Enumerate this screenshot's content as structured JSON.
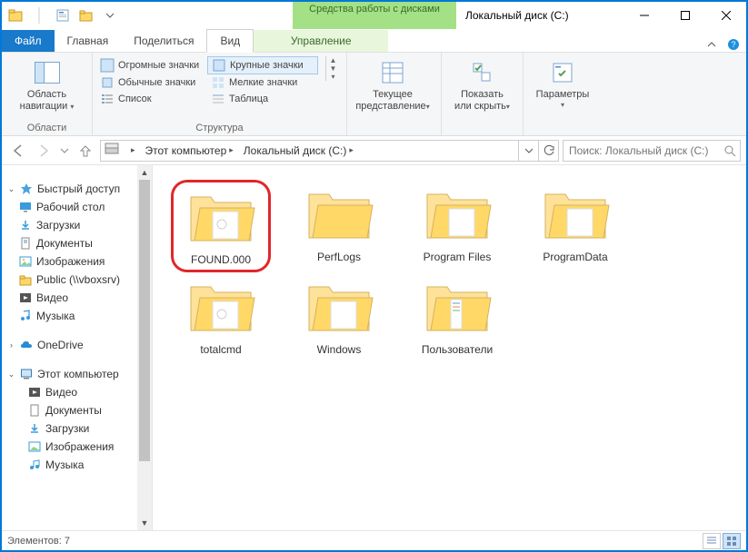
{
  "title": "Локальный диск (C:)",
  "contextual_tab": "Средства работы с дисками",
  "contextual_under": "Управление",
  "file_tab": "Файл",
  "tabs": {
    "t0": "Главная",
    "t1": "Поделиться",
    "t2": "Вид"
  },
  "ribbon": {
    "nav_panes": {
      "line1": "Область",
      "line2": "навигации"
    },
    "views": {
      "o0": "Огромные значки",
      "o1": "Крупные значки",
      "o2": "Обычные значки",
      "o3": "Мелкие значки",
      "o4": "Список",
      "o5": "Таблица"
    },
    "current": {
      "line1": "Текущее",
      "line2": "представление"
    },
    "showhide": {
      "line1": "Показать",
      "line2": "или скрыть"
    },
    "options": "Параметры",
    "g_panes": "Области",
    "g_layout": "Структура"
  },
  "breadcrumb": {
    "b0": "Этот компьютер",
    "b1": "Локальный диск (C:)"
  },
  "search_placeholder": "Поиск: Локальный диск (C:)",
  "nav": {
    "quick": "Быстрый доступ",
    "desktop": "Рабочий стол",
    "downloads": "Загрузки",
    "documents": "Документы",
    "pictures": "Изображения",
    "public": "Public (\\\\vboxsrv)",
    "videos": "Видео",
    "music": "Музыка",
    "onedrive": "OneDrive",
    "thispc": "Этот компьютер",
    "videos2": "Видео",
    "documents2": "Документы",
    "downloads2": "Загрузки",
    "pictures2": "Изображения",
    "music2": "Музыка"
  },
  "folders": {
    "f0": "FOUND.000",
    "f1": "PerfLogs",
    "f2": "Program Files",
    "f3": "ProgramData",
    "f4": "totalcmd",
    "f5": "Windows",
    "f6": "Пользователи"
  },
  "status": "Элементов: 7"
}
